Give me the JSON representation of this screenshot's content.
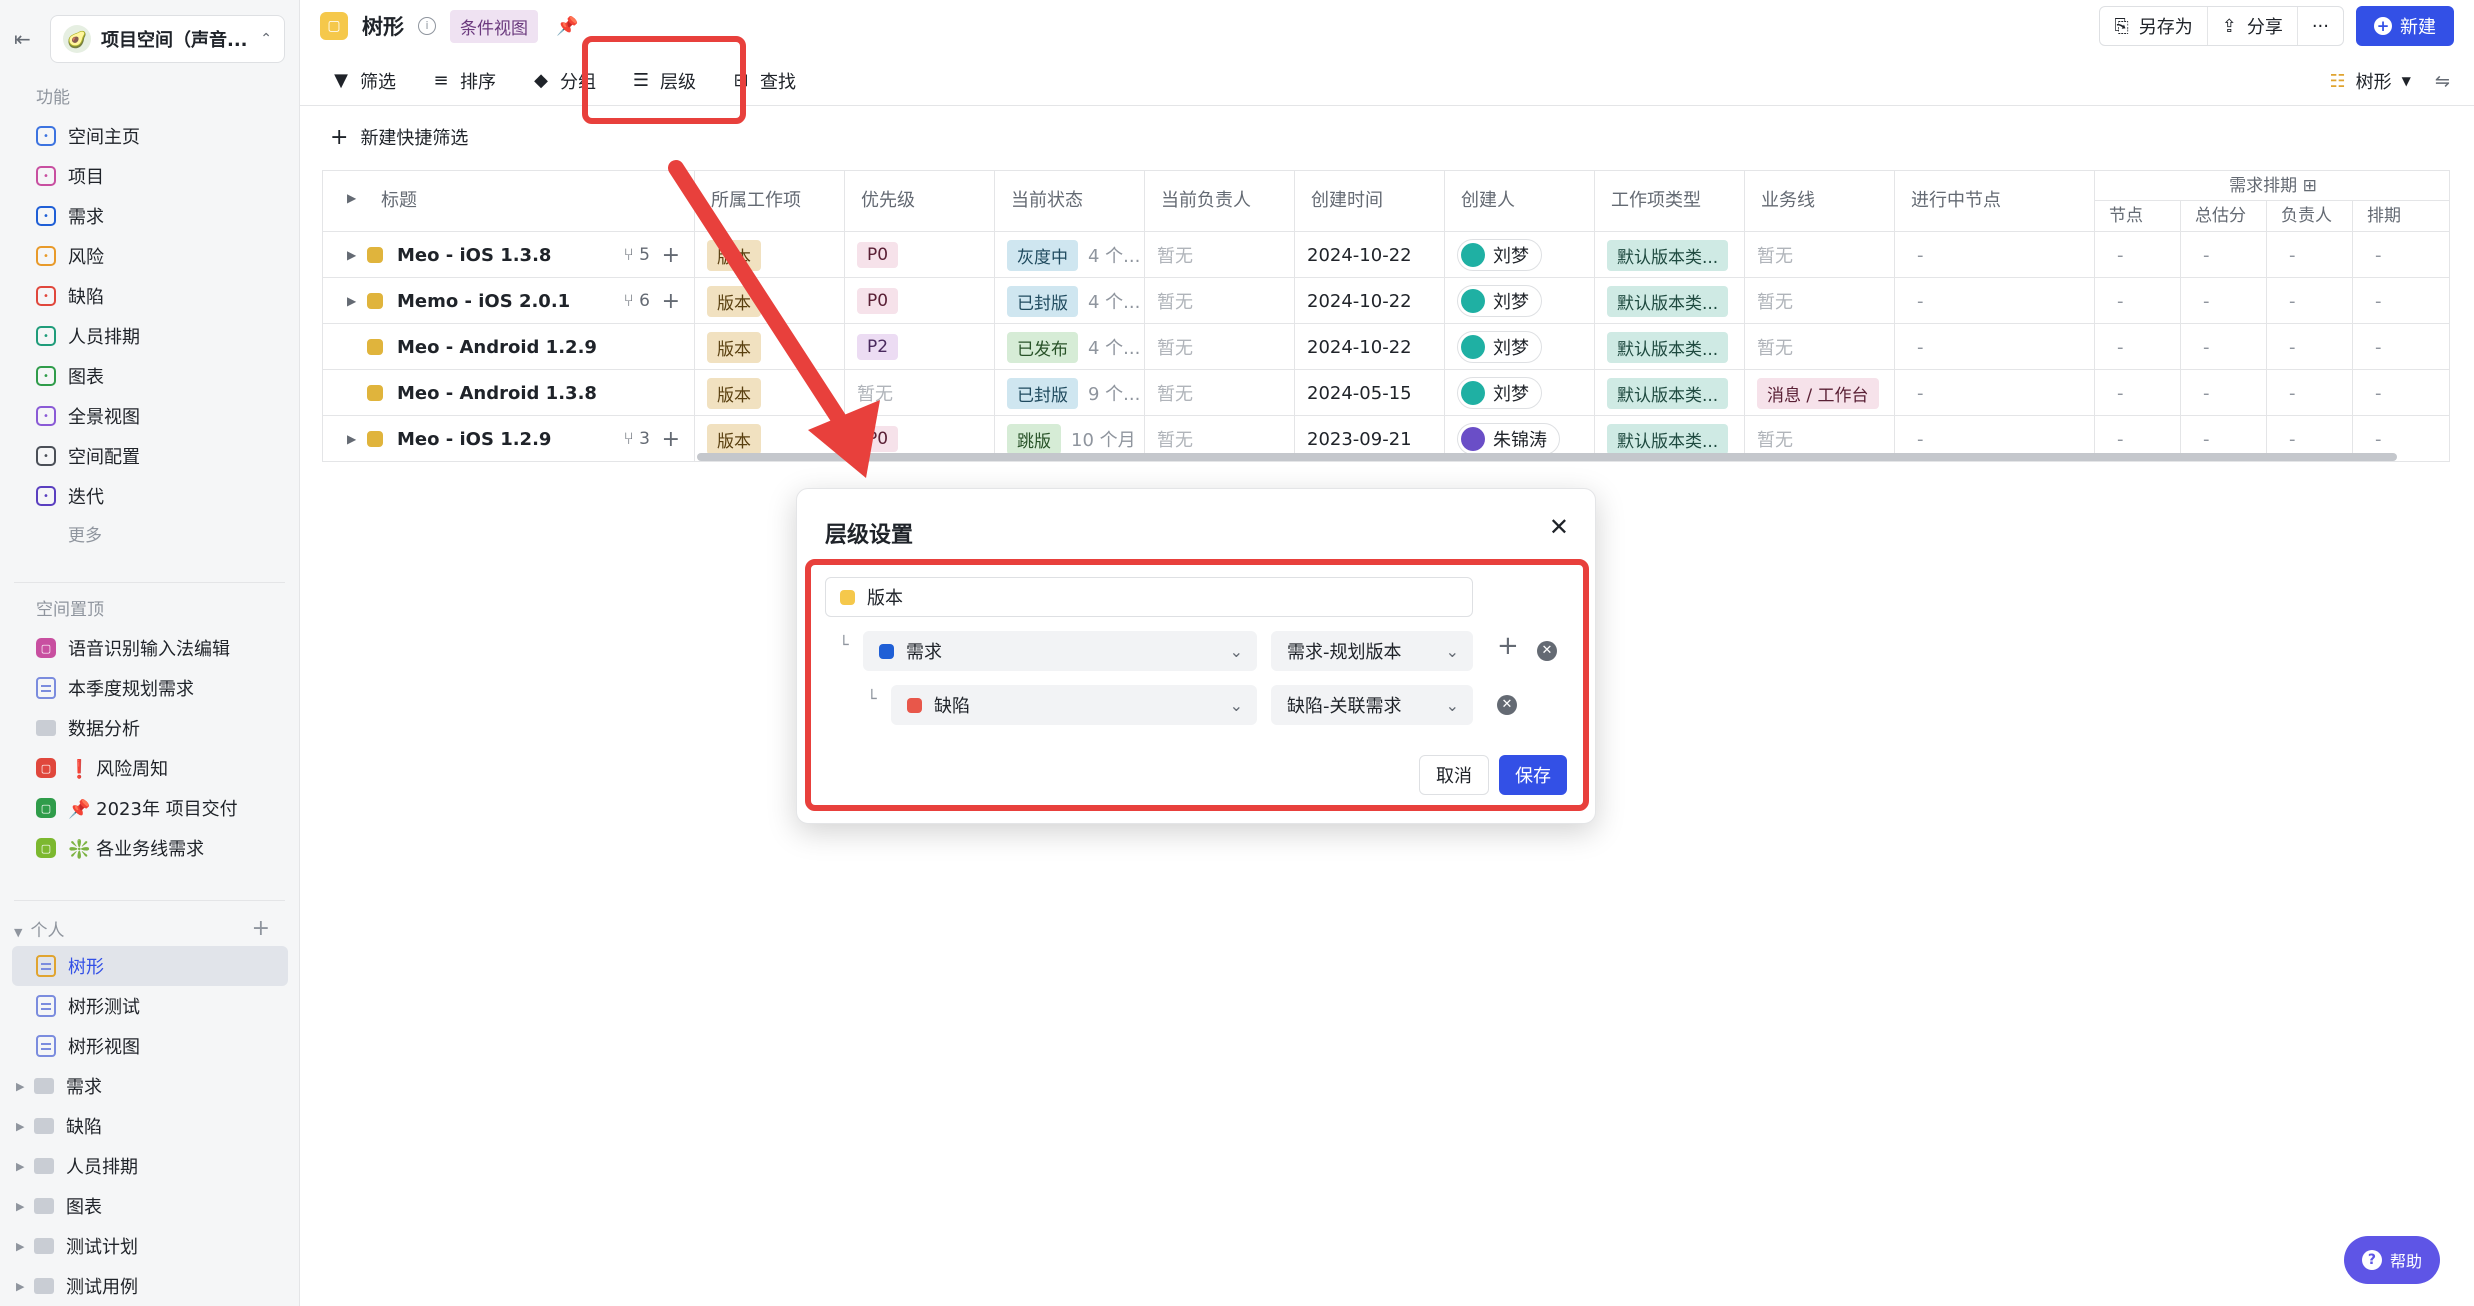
{
  "sidebar": {
    "space_name": "项目空间（声音...",
    "features_title": "功能",
    "features": [
      {
        "label": "空间主页",
        "icon": "home-icon",
        "color": "#3c73e0"
      },
      {
        "label": "项目",
        "icon": "project-icon",
        "color": "#c84fa0"
      },
      {
        "label": "需求",
        "icon": "requirement-icon",
        "color": "#1f5fd6"
      },
      {
        "label": "风险",
        "icon": "risk-icon",
        "color": "#e89a2a"
      },
      {
        "label": "缺陷",
        "icon": "bug-icon",
        "color": "#e0473c"
      },
      {
        "label": "人员排期",
        "icon": "schedule-icon",
        "color": "#1f9c7a"
      },
      {
        "label": "图表",
        "icon": "chart-icon",
        "color": "#2f9c4a"
      },
      {
        "label": "全景视图",
        "icon": "panorama-icon",
        "color": "#8a5ad6"
      },
      {
        "label": "空间配置",
        "icon": "settings-icon",
        "color": "#4a4f57"
      },
      {
        "label": "迭代",
        "icon": "iteration-icon",
        "color": "#5a3fc0"
      }
    ],
    "more_label": "更多",
    "pinned_title": "空间置顶",
    "pinned": [
      {
        "label": "语音识别输入法编辑",
        "icon": "view-icon",
        "color": "#c84fa0"
      },
      {
        "label": "本季度规划需求",
        "icon": "doc-icon",
        "color": "#7b8cde"
      },
      {
        "label": "数据分析",
        "icon": "folder-icon",
        "color": "#c9cdd4"
      },
      {
        "label": "❗ 风险周知",
        "icon": "view-icon",
        "color": "#e0473c"
      },
      {
        "label": "📌 2023年 项目交付",
        "icon": "view-icon",
        "color": "#2f9c4a"
      },
      {
        "label": "❇️ 各业务线需求",
        "icon": "view-icon",
        "color": "#7cb82f"
      }
    ],
    "personal_title": "个人",
    "personal": [
      {
        "label": "树形",
        "active": true
      },
      {
        "label": "树形测试",
        "active": false
      },
      {
        "label": "树形视图",
        "active": false
      }
    ],
    "folders": [
      "需求",
      "缺陷",
      "人员排期",
      "图表",
      "测试计划",
      "测试用例"
    ]
  },
  "topbar": {
    "view_title": "树形",
    "condition_tag": "条件视图",
    "save_as": "另存为",
    "share": "分享",
    "more": "···",
    "new": "新建"
  },
  "toolbar": {
    "filter": "筛选",
    "sort": "排序",
    "group": "分组",
    "level": "层级",
    "find": "查找",
    "view_mode": "树形"
  },
  "quick_filter": "新建快捷筛选",
  "table": {
    "columns": [
      "标题",
      "所属工作项",
      "优先级",
      "当前状态",
      "当前负责人",
      "创建时间",
      "创建人",
      "工作项类型",
      "业务线",
      "进行中节点"
    ],
    "group_header": "需求排期",
    "sub_columns": [
      "节点",
      "总估分",
      "负责人",
      "排期"
    ],
    "rows": [
      {
        "title": "Meo - iOS 1.3.8",
        "expandable": true,
        "sub": "5",
        "item": "版本",
        "priority": "P0",
        "status": "灰度中",
        "status_time": "4 个...",
        "owner": "暂无",
        "created": "2024-10-22",
        "creator": "刘梦",
        "type": "默认版本类...",
        "biz": "暂无",
        "node": "-",
        "s1": "-",
        "s2": "-",
        "s3": "-",
        "s4": "-"
      },
      {
        "title": "Memo - iOS 2.0.1",
        "expandable": true,
        "sub": "6",
        "item": "版本",
        "priority": "P0",
        "status": "已封版",
        "status_time": "4 个...",
        "owner": "暂无",
        "created": "2024-10-22",
        "creator": "刘梦",
        "type": "默认版本类...",
        "biz": "暂无",
        "node": "-",
        "s1": "-",
        "s2": "-",
        "s3": "-",
        "s4": "-"
      },
      {
        "title": "Meo - Android 1.2.9",
        "expandable": false,
        "sub": "",
        "item": "版本",
        "priority": "P2",
        "status": "已发布",
        "status_time": "4 个...",
        "owner": "暂无",
        "created": "2024-10-22",
        "creator": "刘梦",
        "type": "默认版本类...",
        "biz": "暂无",
        "node": "-",
        "s1": "-",
        "s2": "-",
        "s3": "-",
        "s4": "-"
      },
      {
        "title": "Meo - Android 1.3.8",
        "expandable": false,
        "sub": "",
        "item": "版本",
        "priority": "暂无",
        "status": "已封版",
        "status_time": "9 个...",
        "owner": "暂无",
        "created": "2024-05-15",
        "creator": "刘梦",
        "type": "默认版本类...",
        "biz": "消息 / 工作台",
        "node": "-",
        "s1": "-",
        "s2": "-",
        "s3": "-",
        "s4": "-"
      },
      {
        "title": "Meo - iOS 1.2.9",
        "expandable": true,
        "sub": "3",
        "item": "版本",
        "priority": "P0",
        "status": "跳版",
        "status_time": "10 个月",
        "owner": "暂无",
        "created": "2023-09-21",
        "creator": "朱锦涛",
        "type": "默认版本类...",
        "biz": "暂无",
        "node": "-",
        "s1": "-",
        "s2": "-",
        "s3": "-",
        "s4": "-"
      }
    ]
  },
  "modal": {
    "title": "层级设置",
    "root_label": "版本",
    "level1_type": "需求",
    "level1_relation": "需求-规划版本",
    "level2_type": "缺陷",
    "level2_relation": "缺陷-关联需求",
    "cancel": "取消",
    "save": "保存"
  },
  "help": "帮助",
  "colors": {
    "accent": "#3350e6",
    "annotation": "#e8403c",
    "version": "#f5c84b",
    "requirement": "#1f5fd6",
    "bug": "#e8574a"
  }
}
